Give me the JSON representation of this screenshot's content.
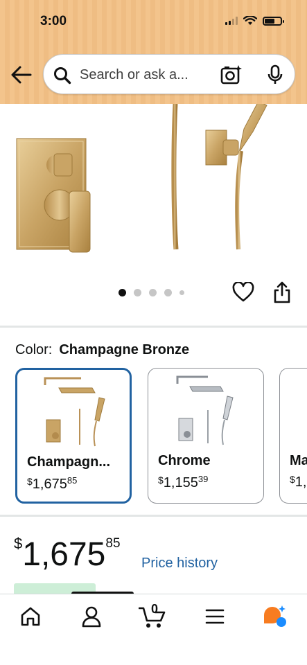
{
  "status_bar": {
    "time": "3:00"
  },
  "header": {
    "search_placeholder": "Search or ask a..."
  },
  "gallery": {
    "image_count": 5,
    "active_index": 0
  },
  "color": {
    "label": "Color:",
    "selected": "Champagne Bronze",
    "options": [
      {
        "name": "Champagn...",
        "price_symbol": "$",
        "price_whole": "1,675",
        "price_cents": "85"
      },
      {
        "name": "Chrome",
        "price_symbol": "$",
        "price_whole": "1,155",
        "price_cents": "39"
      },
      {
        "name": "Ma",
        "price_symbol": "$",
        "price_whole": "1,",
        "price_cents": ""
      }
    ]
  },
  "price": {
    "symbol": "$",
    "whole": "1,675",
    "cents": "85",
    "history_link": "Price history"
  },
  "bottom_nav": {
    "cart_count": "0",
    "items": [
      "home-icon",
      "account-icon",
      "cart-icon",
      "menu-icon",
      "rufus-icon"
    ]
  },
  "colors": {
    "header_bg": "#f2c38a",
    "link": "#2162a1",
    "selected_border": "#2162a1",
    "rufus_orange": "#f77c20",
    "rufus_blue": "#1a8cff"
  }
}
